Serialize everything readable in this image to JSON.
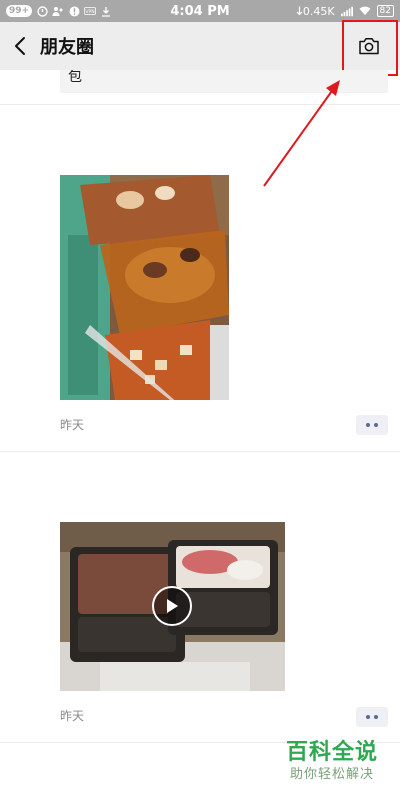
{
  "status_bar": {
    "notification_badge": "99+",
    "time": "4:04 PM",
    "network_speed": "0.45K",
    "battery": "82"
  },
  "nav": {
    "title": "朋友圈"
  },
  "feed": {
    "share_chip_text": "包",
    "posts": [
      {
        "date": "昨天",
        "media": "photo"
      },
      {
        "date": "昨天",
        "media": "video"
      }
    ]
  },
  "watermark": {
    "main": "百科全说",
    "sub": "助你轻松解决"
  },
  "colors": {
    "status_bar": "#a8a8a8",
    "nav_bar": "#ededed",
    "highlight": "#e0191e",
    "more_button_dots": "#5b6b93",
    "watermark": "#2fa84f"
  }
}
